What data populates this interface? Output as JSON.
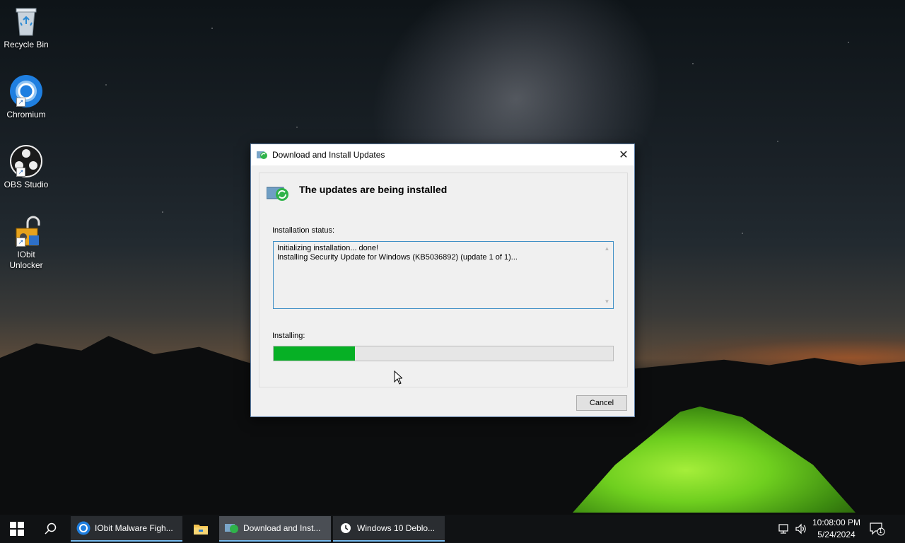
{
  "desktop": {
    "icons": [
      {
        "label": "Recycle Bin",
        "icon": "recycle-bin-icon"
      },
      {
        "label": "Chromium",
        "icon": "chromium-icon"
      },
      {
        "label": "OBS Studio",
        "icon": "obs-studio-icon"
      },
      {
        "label": "IObit Unlocker",
        "icon": "iobit-unlocker-icon"
      }
    ]
  },
  "dialog": {
    "title": "Download and Install Updates",
    "headline": "The updates are being installed",
    "status_label": "Installation status:",
    "status_lines": [
      "Initializing installation... done!",
      "Installing Security Update for Windows (KB5036892) (update 1 of 1)..."
    ],
    "installing_label": "Installing:",
    "progress_fraction": 0.24,
    "cancel_label": "Cancel",
    "colors": {
      "progress": "#06b025",
      "accent": "#3f8fc6"
    }
  },
  "taskbar": {
    "items": [
      {
        "label": "IObit Malware Figh...",
        "icon": "chromium-icon"
      },
      {
        "label": "",
        "icon": "file-explorer-icon"
      },
      {
        "label": "Download and Inst...",
        "icon": "windows-update-icon"
      },
      {
        "label": "Windows 10 Deblo...",
        "icon": "clock-icon"
      }
    ],
    "clock": {
      "time": "10:08:00 PM",
      "date": "5/24/2024"
    },
    "notification_count": "1"
  }
}
